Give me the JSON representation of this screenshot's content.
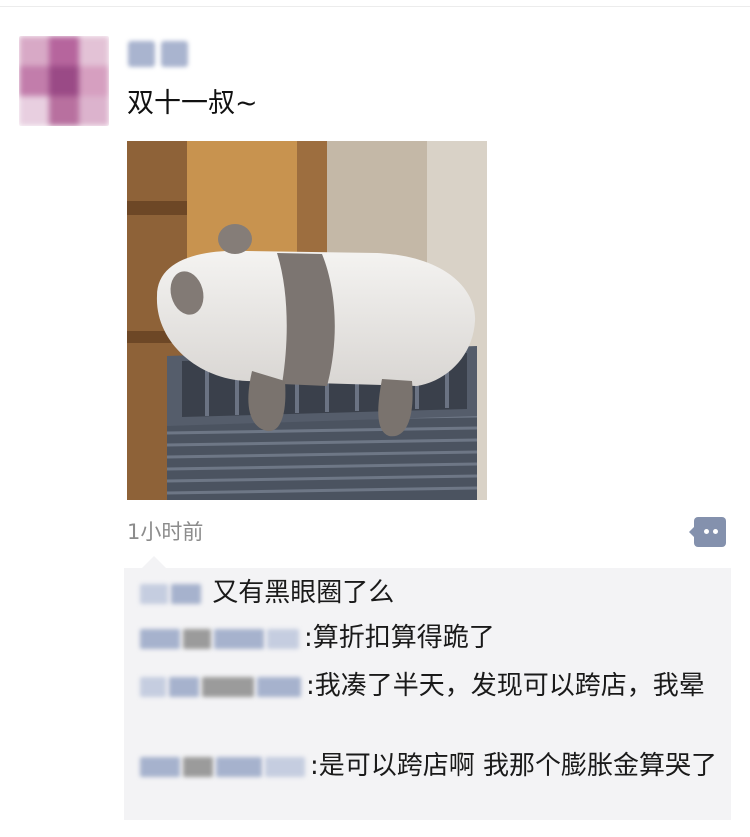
{
  "post": {
    "author_name": "██",
    "text": "双十一叔~",
    "time": "1小时前",
    "image_subject": "panda plush on stacked gray shopping baskets"
  },
  "comments": [
    {
      "author": "██",
      "separator": "",
      "text": "又有黑眼圈了么"
    },
    {
      "author": "██ ██ ██",
      "separator": ":",
      "text": "算折扣算得跪了"
    },
    {
      "author": "██ ██ ██",
      "separator": ":",
      "text": "我凑了半天，发现可以跨店，我晕"
    },
    {
      "author": "██ ██ ██",
      "separator": ":",
      "text": "是可以跨店啊 我那个膨胀金算哭了"
    }
  ],
  "icons": {
    "comment": "comment-bubble-icon"
  },
  "colors": {
    "link_blue": "#576b95",
    "comment_bg": "#f3f3f5",
    "time_gray": "#8c8c8c"
  }
}
